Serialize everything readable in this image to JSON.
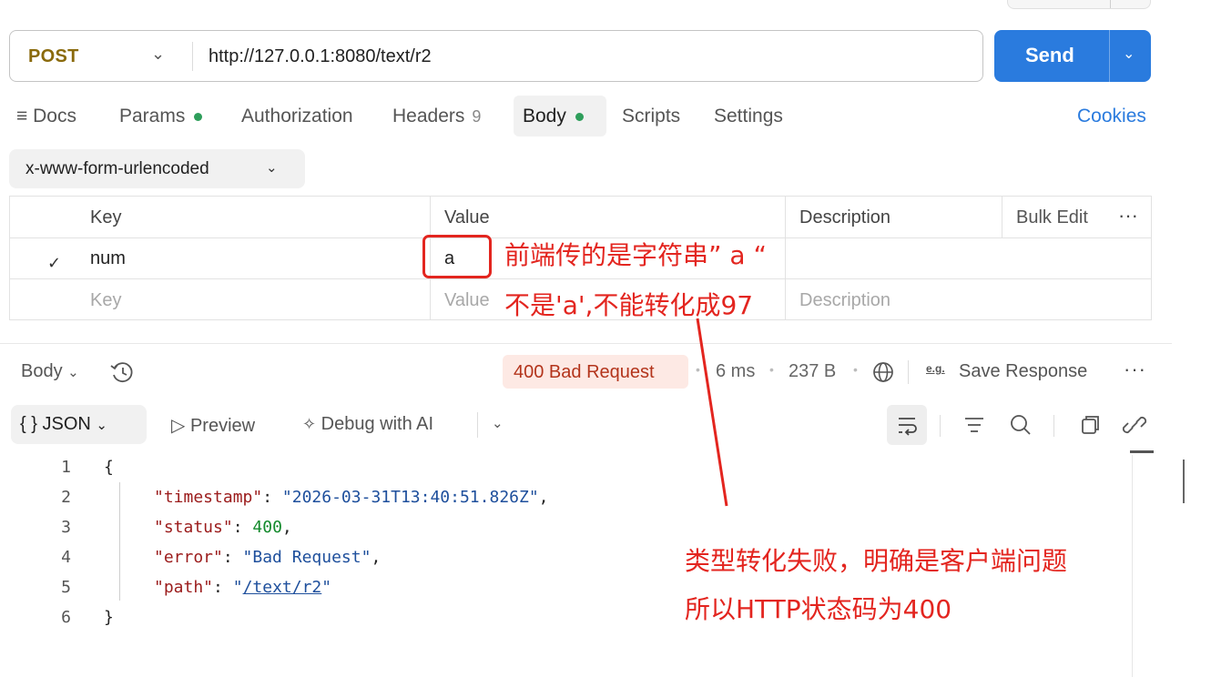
{
  "request": {
    "method": "POST",
    "url": "http://127.0.0.1:8080/text/r2",
    "send_label": "Send"
  },
  "tabs": {
    "docs": "Docs",
    "params": "Params",
    "authorization": "Authorization",
    "headers": "Headers",
    "headers_count": "9",
    "body": "Body",
    "scripts": "Scripts",
    "settings": "Settings",
    "cookies": "Cookies"
  },
  "body_type": "x-www-form-urlencoded",
  "table": {
    "headers": {
      "key": "Key",
      "value": "Value",
      "description": "Description",
      "bulk_edit": "Bulk Edit"
    },
    "rows": [
      {
        "checked": true,
        "key": "num",
        "value": "a",
        "description": ""
      }
    ],
    "placeholder": {
      "key": "Key",
      "value": "Value",
      "description": "Description"
    }
  },
  "response": {
    "body_label": "Body",
    "status": "400 Bad Request",
    "time": "6 ms",
    "size": "237 B",
    "save_response": "Save Response",
    "eg_label": "e.g.",
    "view": "JSON",
    "preview": "Preview",
    "debug": "Debug with AI",
    "lines": [
      "1",
      "2",
      "3",
      "4",
      "5",
      "6"
    ],
    "json": {
      "open": "{",
      "timestamp_key": "\"timestamp\"",
      "timestamp_val": "\"2026-03-31T13:40:51.826Z\"",
      "status_key": "\"status\"",
      "status_val": "400",
      "error_key": "\"error\"",
      "error_val": "\"Bad Request\"",
      "path_key": "\"path\"",
      "path_val": "/text/r2",
      "close": "}"
    }
  },
  "annotations": {
    "a1": "前端传的是字符串” a “",
    "a2": "不是'a',不能转化成97",
    "a3": "类型转化失败，明确是客户端问题",
    "a4": "所以HTTP状态码为400",
    "color": "#e3251f"
  },
  "colors": {
    "method": "#8a6a0c",
    "send": "#2a7bde",
    "status_bg": "#fde9e4",
    "status_fg": "#b3341b",
    "active_dot": "#2e9e5b"
  }
}
